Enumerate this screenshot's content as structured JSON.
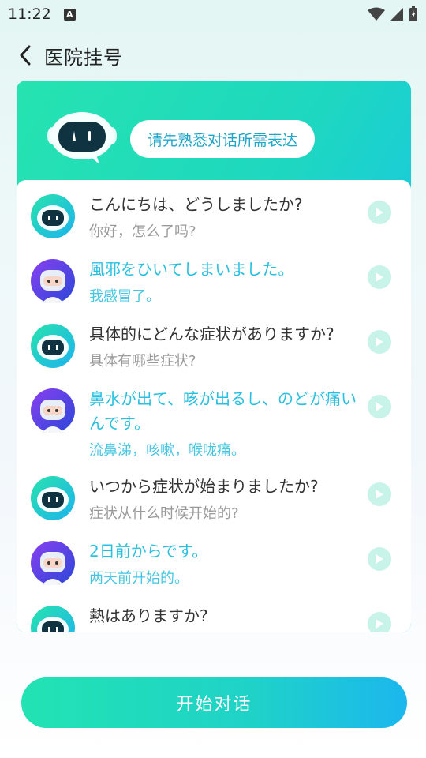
{
  "status_bar": {
    "time": "11:22",
    "notification_icon": "a-badge-icon"
  },
  "header": {
    "title": "医院挂号",
    "back_icon": "chevron-left-icon"
  },
  "hint": {
    "text": "请先熟悉对话所需表达"
  },
  "colors": {
    "accent": "#1ed7c0",
    "user_text": "#28c0e0",
    "muted": "#9a9a9a",
    "play_bg": "#c8f3e9"
  },
  "dialogue": [
    {
      "speaker": "robot",
      "jp": "こんにちは、どうしましたか?",
      "cn": "你好，怎么了吗?"
    },
    {
      "speaker": "user",
      "jp": "風邪をひいてしまいました。",
      "cn": "我感冒了。"
    },
    {
      "speaker": "robot",
      "jp": "具体的にどんな症状がありますか?",
      "cn": "具体有哪些症状?"
    },
    {
      "speaker": "user",
      "jp": "鼻水が出て、咳が出るし、のどが痛いんです。",
      "cn": "流鼻涕，咳嗽，喉咙痛。"
    },
    {
      "speaker": "robot",
      "jp": "いつから症状が始まりましたか?",
      "cn": "症状从什么时候开始的?"
    },
    {
      "speaker": "user",
      "jp": "2日前からです。",
      "cn": "两天前开始的。"
    },
    {
      "speaker": "robot",
      "jp": "熱はありますか?",
      "cn": ""
    }
  ],
  "footer": {
    "start_label": "开始对话"
  }
}
